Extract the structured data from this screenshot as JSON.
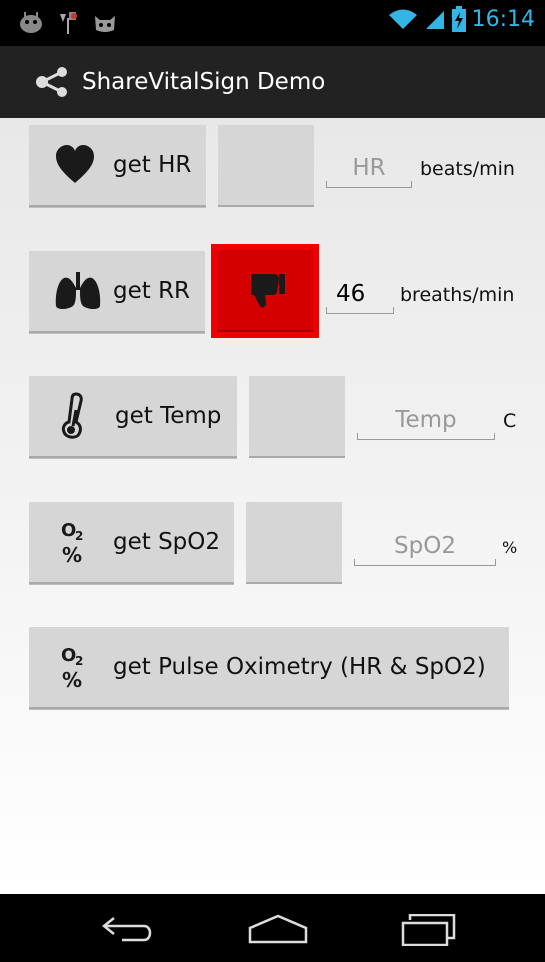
{
  "status_bar": {
    "time": "16:14",
    "left_icons": [
      "android-icon",
      "usb-debug-icon",
      "cat-icon"
    ],
    "right_icons": [
      "wifi-icon",
      "signal-icon",
      "battery-charging-icon"
    ]
  },
  "action_bar": {
    "title": "ShareVitalSign Demo",
    "icon": "share-icon"
  },
  "rows": {
    "hr": {
      "button_label": "get HR",
      "icon": "heart-icon",
      "value": "",
      "placeholder": "HR",
      "unit": "beats/min"
    },
    "rr": {
      "button_label": "get RR",
      "icon": "lungs-icon",
      "value": "46",
      "placeholder": "",
      "unit": "breaths/min",
      "status_icon": "thumbs-down-icon",
      "status_color": "#ee0000"
    },
    "temp": {
      "button_label": "get Temp",
      "icon": "thermometer-icon",
      "value": "",
      "placeholder": "Temp",
      "unit": "C"
    },
    "spo2": {
      "button_label": "get SpO2",
      "icon": "o2-percent-icon",
      "value": "",
      "placeholder": "SpO2",
      "unit": "%"
    },
    "pulse_ox": {
      "button_label": "get Pulse Oximetry (HR & SpO2)",
      "icon": "o2-percent-icon"
    }
  },
  "nav_bar": [
    "back-icon",
    "home-icon",
    "recent-apps-icon"
  ]
}
